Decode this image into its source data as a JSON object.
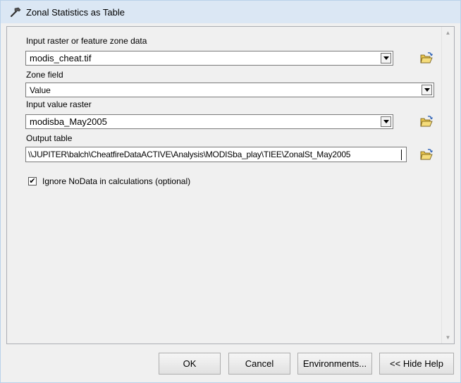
{
  "window": {
    "title": "Zonal Statistics as Table"
  },
  "form": {
    "input_raster_label": "Input raster or feature zone data",
    "input_raster_value": "modis_cheat.tif",
    "zone_field_label": "Zone field",
    "zone_field_value": "Value",
    "input_value_raster_label": "Input value raster",
    "input_value_raster_value": "modisba_May2005",
    "output_table_label": "Output table",
    "output_table_value": "\\\\JUPITER\\balch\\CheatfireDataACTIVE\\Analysis\\MODISba_play\\TIEE\\ZonalSt_May2005",
    "ignore_nodata_label": "Ignore NoData in calculations (optional)",
    "ignore_nodata_checked": "✔"
  },
  "buttons": {
    "ok": "OK",
    "cancel": "Cancel",
    "environments": "Environments...",
    "hide_help": "<< Hide Help"
  },
  "icons": {
    "title": "hammer-icon",
    "browse": "open-folder-icon"
  }
}
